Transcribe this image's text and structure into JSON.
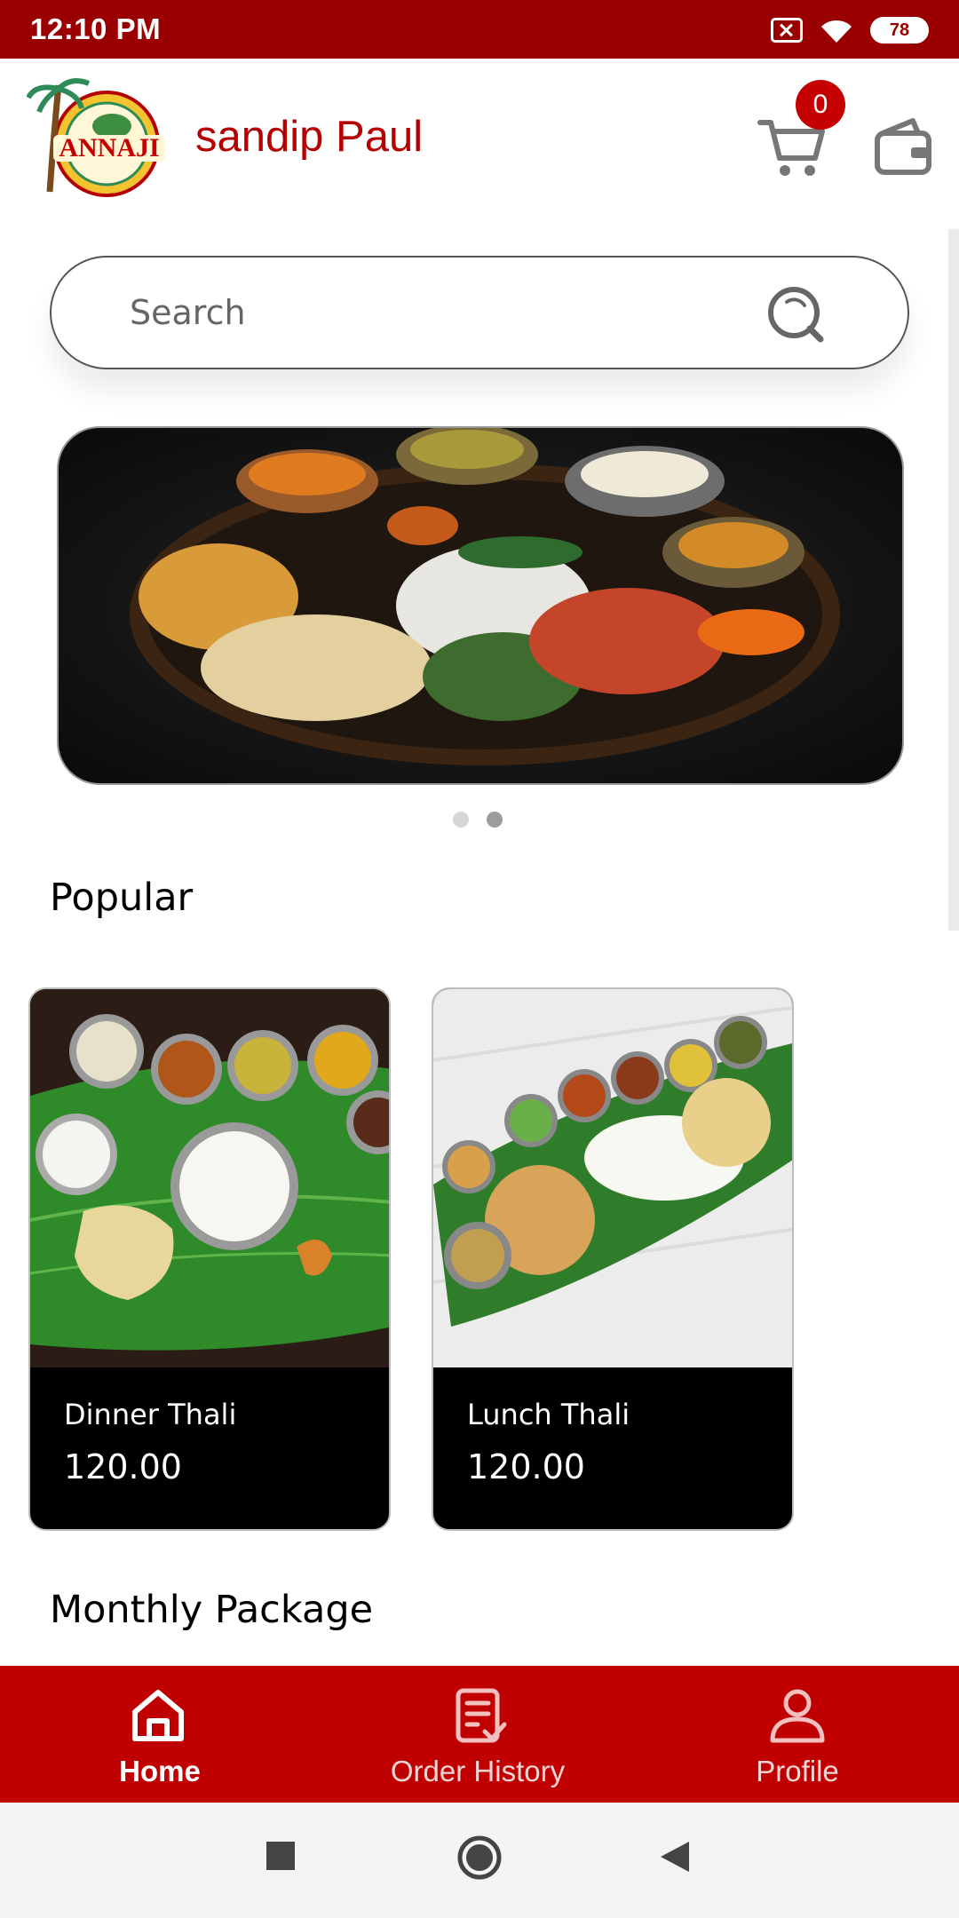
{
  "status_bar": {
    "time": "12:10 PM",
    "battery": "78"
  },
  "header": {
    "user_name": "sandip Paul",
    "cart_count": "0",
    "logo_text": "ANNAJI"
  },
  "search": {
    "placeholder": "Search"
  },
  "banner": {
    "dots": 2,
    "active_dot": 2
  },
  "sections": {
    "popular": "Popular",
    "monthly": "Monthly Package"
  },
  "popular_items": [
    {
      "name": "Dinner Thali",
      "price": "120.00"
    },
    {
      "name": "Lunch Thali",
      "price": "120.00"
    }
  ],
  "bottom_nav": {
    "items": [
      {
        "label": "Home",
        "icon": "home-icon",
        "active": true
      },
      {
        "label": "Order History",
        "icon": "order-history-icon",
        "active": false
      },
      {
        "label": "Profile",
        "icon": "profile-icon",
        "active": false
      }
    ]
  },
  "colors": {
    "brand_red": "#9b0000",
    "nav_red": "#c00000",
    "name_red": "#b40000"
  },
  "icons": [
    "cart-icon",
    "wallet-icon",
    "search-icon",
    "home-icon",
    "order-history-icon",
    "profile-icon"
  ]
}
